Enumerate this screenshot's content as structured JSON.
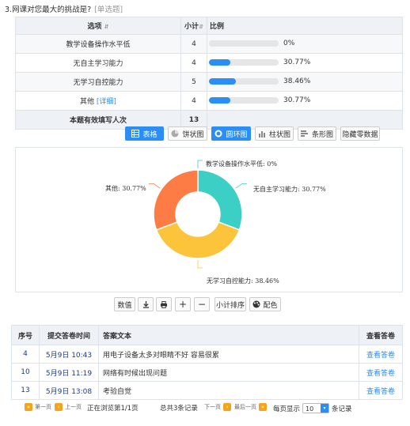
{
  "question": {
    "title": "3.网课对您最大的挑战是?",
    "type": "[单选题]"
  },
  "stats": {
    "headers": {
      "option": "选项",
      "count": "小计",
      "ratio": "比例"
    },
    "sort_icon": "sort-icon",
    "rows": [
      {
        "option": "教学设备操作水平低",
        "count": "4",
        "percent": "0%",
        "fill": 0
      },
      {
        "option": "无自主学习能力",
        "count": "4",
        "percent": "30.77%",
        "fill": 30.77
      },
      {
        "option": "无学习自控能力",
        "count": "5",
        "percent": "38.46%",
        "fill": 38.46
      },
      {
        "option": "其他",
        "detail": "[详细]",
        "count": "4",
        "percent": "30.77%",
        "fill": 30.77
      }
    ],
    "total": {
      "label": "本题有效填写人次",
      "count": "13"
    }
  },
  "toolbar": {
    "table": "表格",
    "pie": "饼状图",
    "donut": "圆环图",
    "bar": "柱状图",
    "hbar": "条形图",
    "hide_zero": "隐藏零数据",
    "accent": "#2a8ef5"
  },
  "chart_data": {
    "type": "pie",
    "variant": "donut",
    "slices": [
      {
        "label": "教学设备操作水平低",
        "text": "教学设备操作水平低: 0%",
        "value": 0,
        "color": "#3cc9c0"
      },
      {
        "label": "无自主学习能力",
        "text": "无自主学习能力: 30.77%",
        "value": 30.77,
        "color": "#3ccfc6"
      },
      {
        "label": "无学习自控能力",
        "text": "无学习自控能力: 38.46%",
        "value": 38.46,
        "color": "#fcc43a"
      },
      {
        "label": "其他",
        "text": "其他: 30.77%",
        "value": 30.77,
        "color": "#fd7c45"
      }
    ]
  },
  "chart_tools": {
    "values": "数值",
    "sort": "小计排序",
    "color": "配色"
  },
  "answers": {
    "headers": {
      "no": "序号",
      "time": "提交答卷时间",
      "text": "答案文本",
      "view": "查看答卷"
    },
    "rows": [
      {
        "no": "4",
        "time": "5月9日 10:43",
        "text": "用电子设备太多对眼睛不好 容易很累",
        "view": "查看答卷"
      },
      {
        "no": "10",
        "time": "5月9日 11:19",
        "text": "网络有时候出现问题",
        "view": "查看答卷"
      },
      {
        "no": "13",
        "time": "5月9日 13:08",
        "text": "考验自觉",
        "view": "查看答卷"
      }
    ]
  },
  "pager": {
    "first": "第一页",
    "prev": "上一页",
    "browsing": "正在浏览第1/1页",
    "total": "总共3条记录",
    "next": "下一页",
    "last": "最后一页",
    "per_page_label": "每页显示",
    "per_page_value": "10",
    "records_unit": "条记录"
  }
}
